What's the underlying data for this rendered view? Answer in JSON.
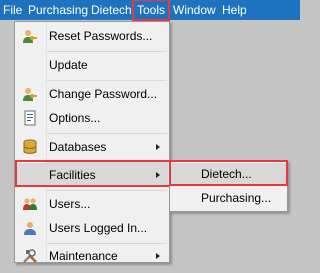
{
  "menubar": {
    "items": [
      {
        "label": "File"
      },
      {
        "label": "Purchasing"
      },
      {
        "label": "Dietech"
      },
      {
        "label": "Tools"
      },
      {
        "label": "Window"
      },
      {
        "label": "Help"
      }
    ],
    "active": "Tools"
  },
  "tools_menu": {
    "items": [
      {
        "label": "Reset Passwords...",
        "icon": "user-key-icon"
      },
      {
        "label": "Update",
        "icon": ""
      },
      {
        "label": "Change Password...",
        "icon": "user-key-icon"
      },
      {
        "label": "Options...",
        "icon": "options-icon"
      },
      {
        "label": "Databases",
        "icon": "database-icon",
        "submenu": true
      },
      {
        "label": "Facilities",
        "icon": "",
        "submenu": true,
        "highlighted": true
      },
      {
        "label": "Users...",
        "icon": "users-icon"
      },
      {
        "label": "Users Logged In...",
        "icon": "user-icon"
      },
      {
        "label": "Maintenance",
        "icon": "tools-icon",
        "submenu": true
      }
    ]
  },
  "facilities_submenu": {
    "items": [
      {
        "label": "Dietech...",
        "highlighted": true
      },
      {
        "label": "Purchasing..."
      }
    ]
  },
  "colors": {
    "menubar_bg": "#1e73be",
    "highlight_outline": "#e3393f",
    "desktop_bg": "#c4c4c4"
  }
}
